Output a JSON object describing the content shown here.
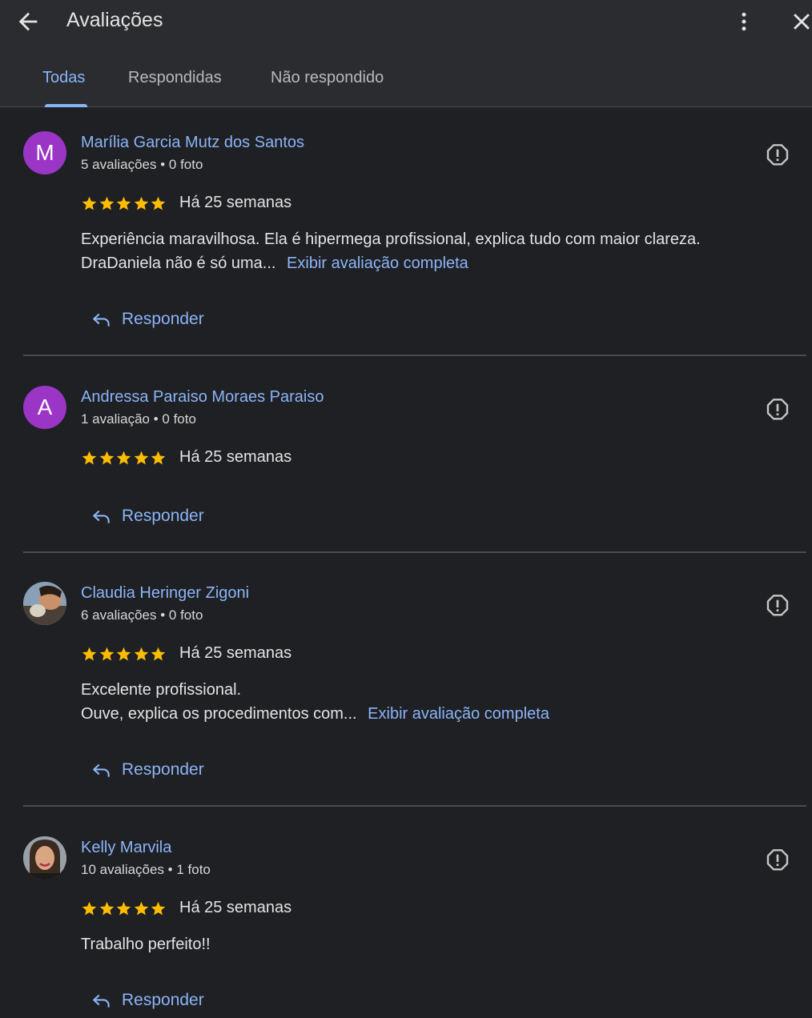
{
  "header": {
    "title": "Avaliações"
  },
  "tabs": [
    {
      "label": "Todas"
    },
    {
      "label": "Respondidas"
    },
    {
      "label": "Não respondido"
    }
  ],
  "colors": {
    "accent": "#8ab4f8",
    "star": "#fbbc04",
    "avatar_purple": "#9a35c6"
  },
  "reviews": [
    {
      "avatar_letter": "M",
      "name": "Marília Garcia Mutz dos Santos",
      "meta": "5 avaliações • 0 foto",
      "rating": 5,
      "time": "Há 25 semanas",
      "text_line1": "Experiência maravilhosa. Ela é hipermega profissional, explica tudo com maior clareza.",
      "text_line2": "DraDaniela não é só uma...",
      "more_link": "Exibir avaliação completa",
      "reply_label": "Responder"
    },
    {
      "avatar_letter": "A",
      "name": "Andressa Paraiso Moraes Paraiso",
      "meta": "1 avaliação • 0 foto",
      "rating": 5,
      "time": "Há 25 semanas",
      "reply_label": "Responder"
    },
    {
      "name": "Claudia Heringer Zigoni",
      "meta": "6 avaliações • 0 foto",
      "rating": 5,
      "time": "Há 25 semanas",
      "text_line1": "Excelente profissional.",
      "text_line2": "Ouve, explica os procedimentos com...",
      "more_link": "Exibir avaliação completa",
      "reply_label": "Responder"
    },
    {
      "name": "Kelly Marvila",
      "meta": "10 avaliações • 1 foto",
      "rating": 5,
      "time": "Há 25 semanas",
      "text_line1": "Trabalho perfeito!!",
      "reply_label": "Responder"
    }
  ]
}
